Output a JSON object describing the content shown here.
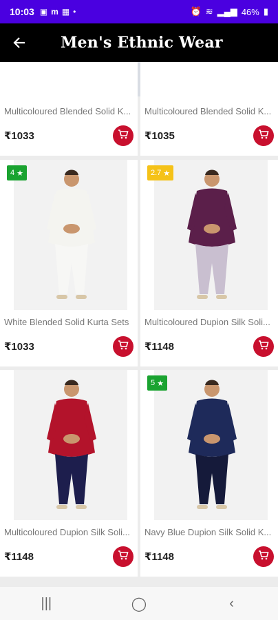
{
  "status": {
    "time": "10:03",
    "battery": "46%"
  },
  "appbar": {
    "title": "Men's Ethnic Wear"
  },
  "top_cards": [
    {
      "name": "Multicoloured Blended Solid K...",
      "price": "₹1033"
    },
    {
      "name": "Multicoloured Blended Solid K...",
      "price": "₹1035"
    }
  ],
  "cards": [
    {
      "name": "White Blended Solid Kurta Sets",
      "price": "₹1033",
      "rating": "4",
      "rating_color": "#1aa330",
      "kurta": "#f4f4f0",
      "pants": "#f7f7f5"
    },
    {
      "name": "Multicoloured Dupion Silk Soli...",
      "price": "₹1148",
      "rating": "2.7",
      "rating_color": "#f5c218",
      "kurta": "#5b1f4a",
      "pants": "#c9bfd0"
    },
    {
      "name": "Multicoloured Dupion Silk Soli...",
      "price": "₹1148",
      "rating": "",
      "rating_color": "",
      "kurta": "#b3132b",
      "pants": "#1d1e4d"
    },
    {
      "name": "Navy Blue Dupion Silk Solid K...",
      "price": "₹1148",
      "rating": "5",
      "rating_color": "#1aa330",
      "kurta": "#1e2a5a",
      "pants": "#151a3a"
    }
  ],
  "colors": {
    "accent": "#c8102e",
    "statusbar": "#4a00e0",
    "appbar": "#000000"
  }
}
